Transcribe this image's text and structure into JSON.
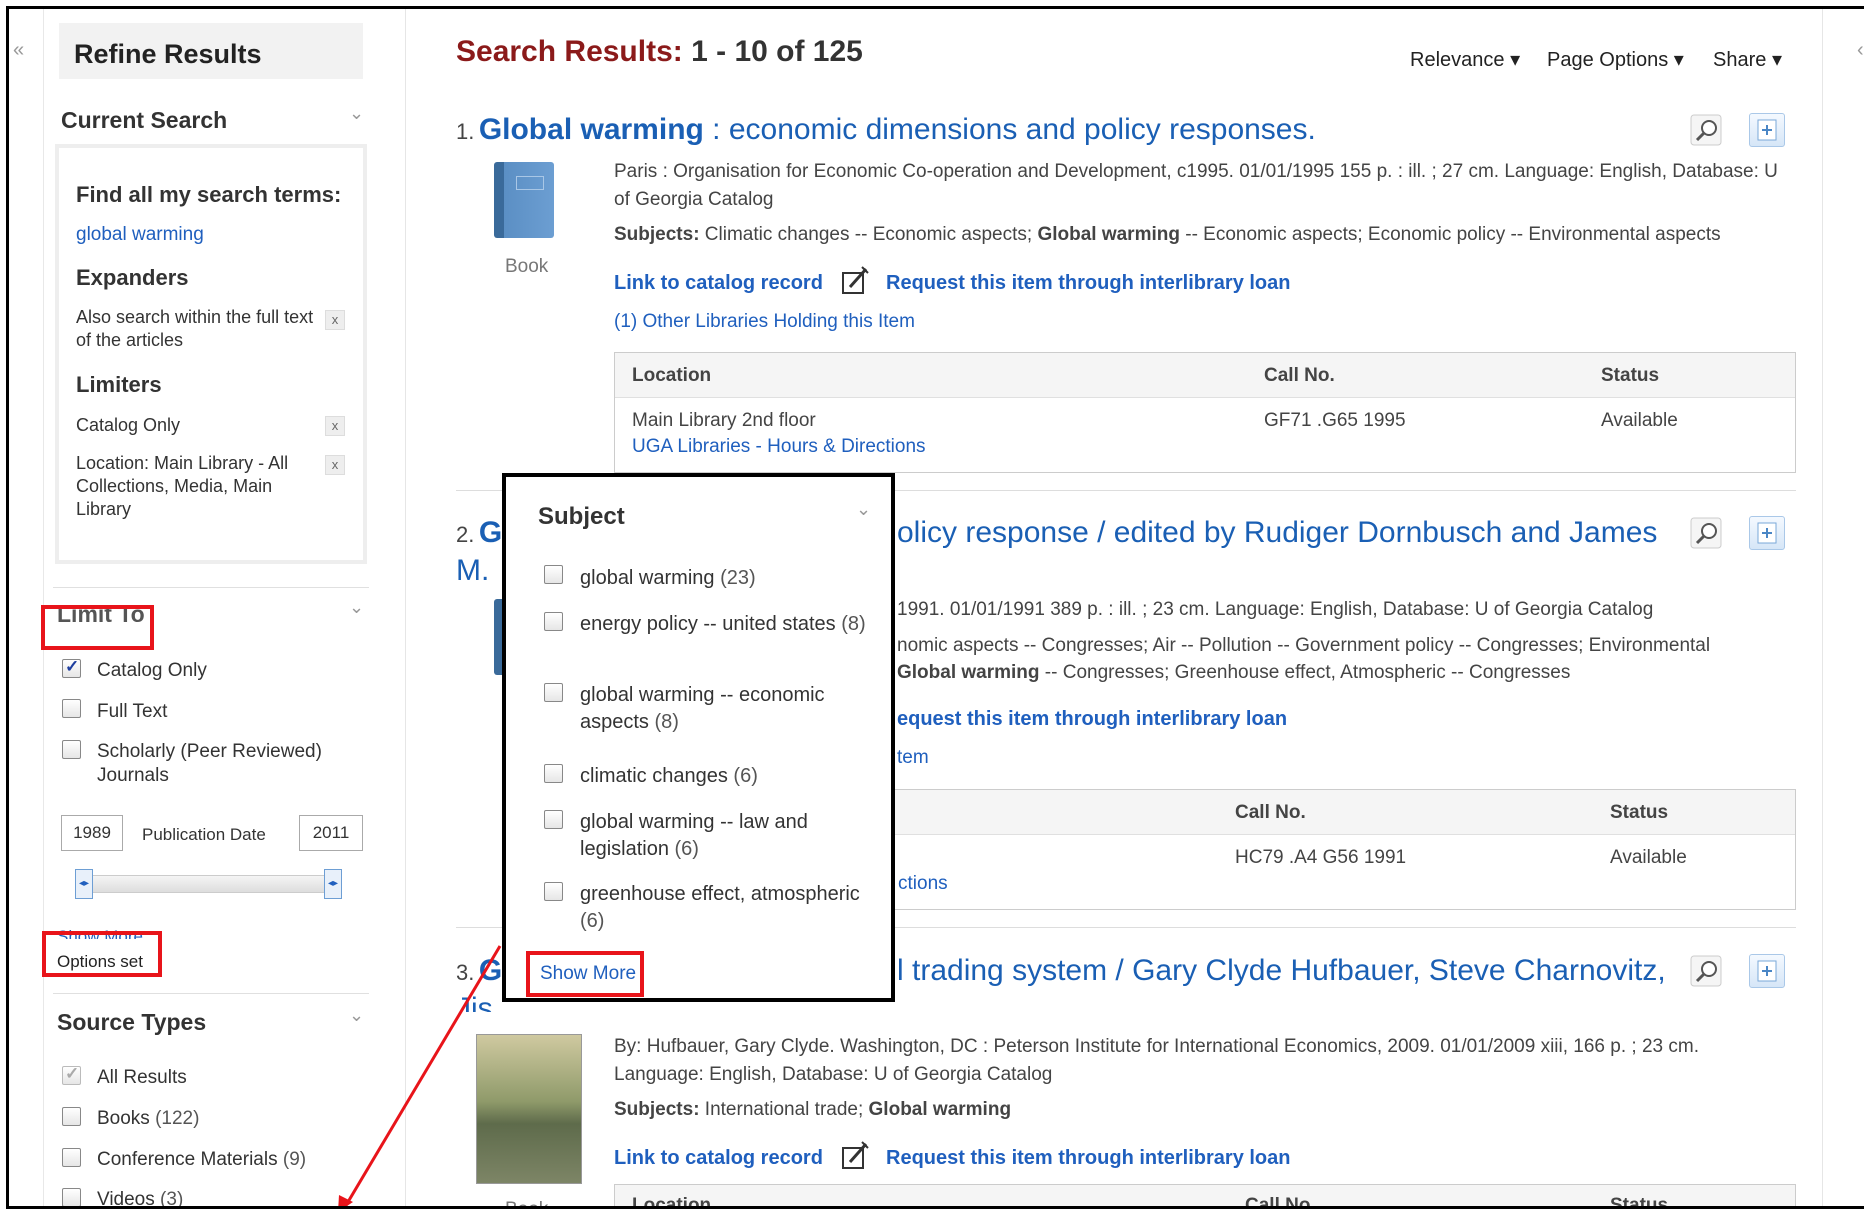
{
  "sidebar": {
    "collapse_glyph": "«",
    "title": "Refine Results",
    "current_search": {
      "heading": "Current Search",
      "find_all_label": "Find all my search terms:",
      "term": "global warming",
      "expanders_heading": "Expanders",
      "expander": "Also search within the full text of the articles",
      "limiters_heading": "Limiters",
      "limiter1": "Catalog Only",
      "limiter2": "Location: Main Library - All Collections, Media, Main Library",
      "remove": "x"
    },
    "limit_to": {
      "heading": "Limit To",
      "items": [
        {
          "label": "Catalog Only",
          "checked": true
        },
        {
          "label": "Full Text",
          "checked": false
        },
        {
          "label": "Scholarly (Peer Reviewed) Journals",
          "checked": false
        }
      ],
      "date_from": "1989",
      "date_label": "Publication Date",
      "date_to": "2011",
      "show_more": "Show More",
      "options_set": "Options set"
    },
    "source_types": {
      "heading": "Source Types",
      "items": [
        {
          "label": "All Results",
          "count": "",
          "checked": true
        },
        {
          "label": "Books",
          "count": "(122)",
          "checked": false
        },
        {
          "label": "Conference Materials",
          "count": "(9)",
          "checked": false
        },
        {
          "label": "Videos",
          "count": "(3)",
          "checked": false
        }
      ]
    }
  },
  "header": {
    "label": "Search Results:",
    "range": "1 - 10 of 125",
    "sort": "Relevance",
    "page_options": "Page Options",
    "share": "Share",
    "caret": "▾"
  },
  "results": [
    {
      "num": "1.",
      "title_bold": "Global warming",
      "title_rest": " : economic dimensions and policy responses.",
      "type": "Book",
      "meta": "Paris : Organisation for Economic Co-operation and Development, c1995. 01/01/1995 155 p. : ill. ; 27 cm. Language: English, Database: U of Georgia Catalog",
      "subjects_label": "Subjects:",
      "subjects_a": " Climatic changes -- Economic aspects; ",
      "subjects_b": "Global warming",
      "subjects_c": " -- Economic aspects; Economic policy -- Environmental aspects",
      "link_catalog": "Link to catalog record",
      "link_ill": "Request this item through interlibrary loan",
      "other_libs": "(1) Other Libraries Holding this Item",
      "table": {
        "h_location": "Location",
        "h_call": "Call No.",
        "h_status": "Status",
        "location": "Main Library 2nd floor",
        "hours": "UGA Libraries - Hours & Directions",
        "call": "GF71 .G65 1995",
        "status": "Available"
      }
    },
    {
      "num": "2.",
      "title_bold": "G",
      "title_rest": "olicy response / edited by Rudiger Dornbusch and James",
      "title_line2": "M.",
      "meta": "1991. 01/01/1991 389 p. : ill. ; 23 cm. Language: English, Database: U of Georgia Catalog",
      "subjects_line1": "nomic aspects -- Congresses; Air -- Pollution -- Government policy -- Congresses; Environmental",
      "subjects_line2_bold": "Global warming",
      "subjects_line2_rest": " -- Congresses; Greenhouse effect, Atmospheric -- Congresses",
      "link_ill": "equest this item through interlibrary loan",
      "other_libs": "tem",
      "table": {
        "h_call": "Call No.",
        "h_status": "Status",
        "call": "HC79 .A4 G56 1991",
        "status": "Available",
        "hours": "ctions"
      }
    },
    {
      "num": "3.",
      "title_bold": "G",
      "title_rest": "l trading system / Gary Clyde Hufbauer, Steve Charnovitz,",
      "title_line2": "Jis",
      "type": "Book",
      "meta": "By: Hufbauer, Gary Clyde. Washington, DC : Peterson Institute for International Economics, 2009. 01/01/2009 xiii, 166 p. ; 23 cm. Language: English, Database: U of Georgia Catalog",
      "subjects_label": "Subjects:",
      "subjects_a": " International trade; ",
      "subjects_b": "Global warming",
      "link_catalog": "Link to catalog record",
      "link_ill": "Request this item through interlibrary loan",
      "table": {
        "h_location": "Location",
        "h_call": "Call No.",
        "h_status": "Status"
      }
    }
  ],
  "popup": {
    "heading": "Subject",
    "items": [
      {
        "label": "global warming",
        "count": "(23)"
      },
      {
        "label": "energy policy -- united states",
        "count": "(8)"
      },
      {
        "label": "global warming -- economic aspects",
        "count": "(8)"
      },
      {
        "label": "climatic changes",
        "count": "(6)"
      },
      {
        "label": "global warming -- law and legislation",
        "count": "(6)"
      },
      {
        "label": "greenhouse effect, atmospheric",
        "count": "(6)"
      }
    ],
    "show_more": "Show More"
  },
  "colors": {
    "title": "#8b1a1a",
    "link": "#1f5fbe",
    "annotation": "#e8141a"
  },
  "icons": [
    "collapse-icon",
    "chevron-down-icon",
    "book-icon",
    "preview-magnifier-icon",
    "add-to-folder-icon",
    "edit-request-icon",
    "remove-x-icon",
    "slider-handle-icon",
    "close-icon"
  ]
}
